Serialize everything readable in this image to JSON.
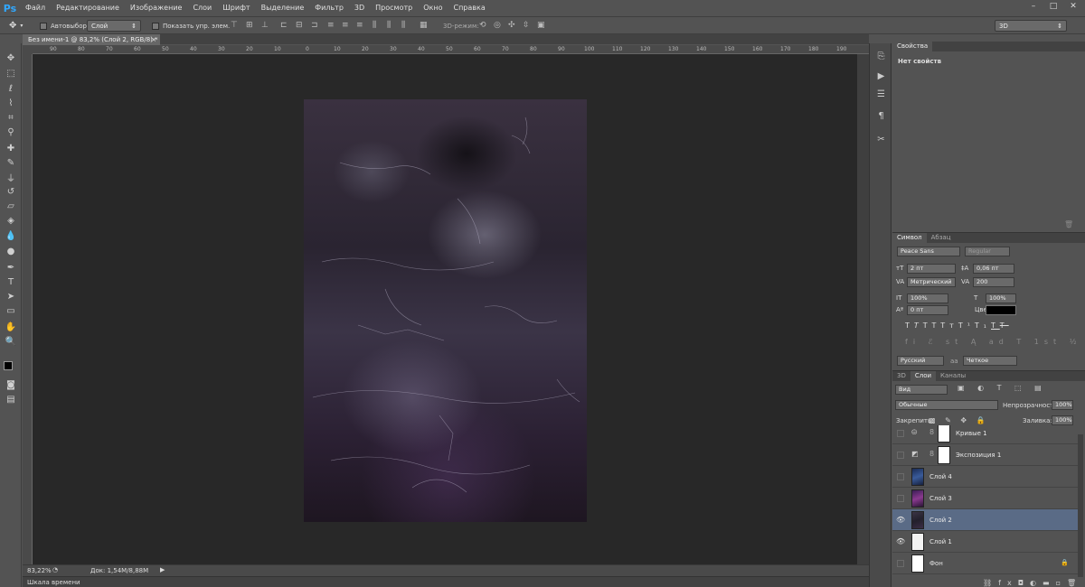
{
  "app": {
    "logo": "Ps"
  },
  "menu": [
    "Файл",
    "Редактирование",
    "Изображение",
    "Слои",
    "Шрифт",
    "Выделение",
    "Фильтр",
    "3D",
    "Просмотр",
    "Окно",
    "Справка"
  ],
  "window_controls": {
    "minimize": "–",
    "maximize": "□",
    "close": "✕"
  },
  "options_bar": {
    "autoselect_label": "Автовыбор:",
    "autoselect_value": "Слой",
    "show_controls_label": "Показать упр. элем.",
    "mode_3d_label": "3D-режим:",
    "workspace_value": "3D"
  },
  "document": {
    "tab_title": "Без имени-1 @ 83,2% (Слой 2, RGB/8) *",
    "close": "×",
    "zoom": "83,22%",
    "doc_size": "Док: 1,54M/8,88M"
  },
  "ruler_h_labels": [
    "90",
    "80",
    "70",
    "60",
    "50",
    "40",
    "30",
    "20",
    "10",
    "0",
    "10",
    "20",
    "30",
    "40",
    "50",
    "60",
    "70",
    "80",
    "90",
    "100",
    "110",
    "120",
    "130",
    "140",
    "150",
    "160",
    "170",
    "180",
    "190"
  ],
  "timeline_label": "Шкала времени",
  "properties": {
    "tab": "Свойства",
    "message": "Нет свойств"
  },
  "character": {
    "tabs": [
      "Символ",
      "Абзац"
    ],
    "font_family": "Peace Sans",
    "font_style": "Regular",
    "font_size": "2 пт",
    "leading": "0,06 пт",
    "kerning": "Метрический",
    "tracking": "200",
    "vscale": "100%",
    "hscale": "100%",
    "baseline": "0 пт",
    "color_label": "Цвет:",
    "color": "#000000",
    "language": "Русский",
    "aa_label": "aa",
    "antialias": "Четкое",
    "style_buttons": [
      "T",
      "T",
      "TT",
      "Tт",
      "T¹",
      "T₁",
      "T",
      "T"
    ]
  },
  "layers_panel": {
    "tabs": [
      "3D",
      "Слои",
      "Каналы"
    ],
    "filter": "Вид",
    "blend_mode": "Обычные",
    "opacity_label": "Непрозрачность:",
    "opacity": "100%",
    "lock_label": "Закрепить:",
    "fill_label": "Заливка:",
    "fill": "100%",
    "layers": [
      {
        "name": "Кривые 1",
        "visible": false,
        "selected": false,
        "kind": "adjustment"
      },
      {
        "name": "Экспозиция 1",
        "visible": false,
        "selected": false,
        "kind": "adjustment"
      },
      {
        "name": "Слой 4",
        "visible": false,
        "selected": false,
        "kind": "blue",
        "thumb_color": "#23365f"
      },
      {
        "name": "Слой 3",
        "visible": false,
        "selected": false,
        "kind": "purple",
        "thumb_color": "#5a2c70"
      },
      {
        "name": "Слой 2",
        "visible": true,
        "selected": true,
        "kind": "dark",
        "thumb_color": "#2a2433"
      },
      {
        "name": "Слой 1",
        "visible": true,
        "selected": false,
        "kind": "white",
        "thumb_color": "#f2f2f2"
      },
      {
        "name": "Фон",
        "visible": false,
        "selected": false,
        "kind": "bg",
        "thumb_color": "#ffffff"
      }
    ]
  },
  "colors": {
    "accent": "#31a8ff",
    "selection": "#5a6b86",
    "canvas_bg": "#282828",
    "ui": "#535353"
  }
}
